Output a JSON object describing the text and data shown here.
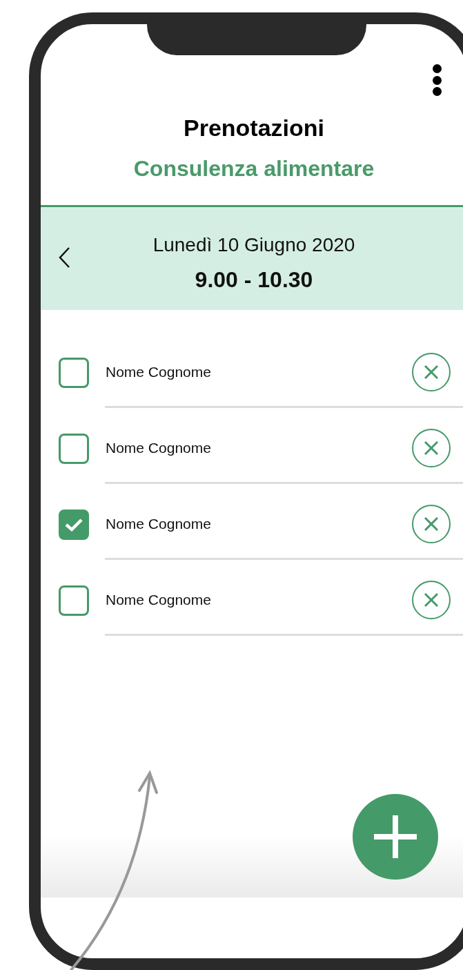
{
  "header": {
    "title": "Prenotazioni",
    "subtitle": "Consulenza alimentare"
  },
  "slot": {
    "date": "Lunedì 10 Giugno 2020",
    "time": "9.00 - 10.30"
  },
  "bookings": [
    {
      "name": "Nome Cognome",
      "checked": false
    },
    {
      "name": "Nome Cognome",
      "checked": false
    },
    {
      "name": "Nome Cognome",
      "checked": true
    },
    {
      "name": "Nome Cognome",
      "checked": false
    }
  ]
}
